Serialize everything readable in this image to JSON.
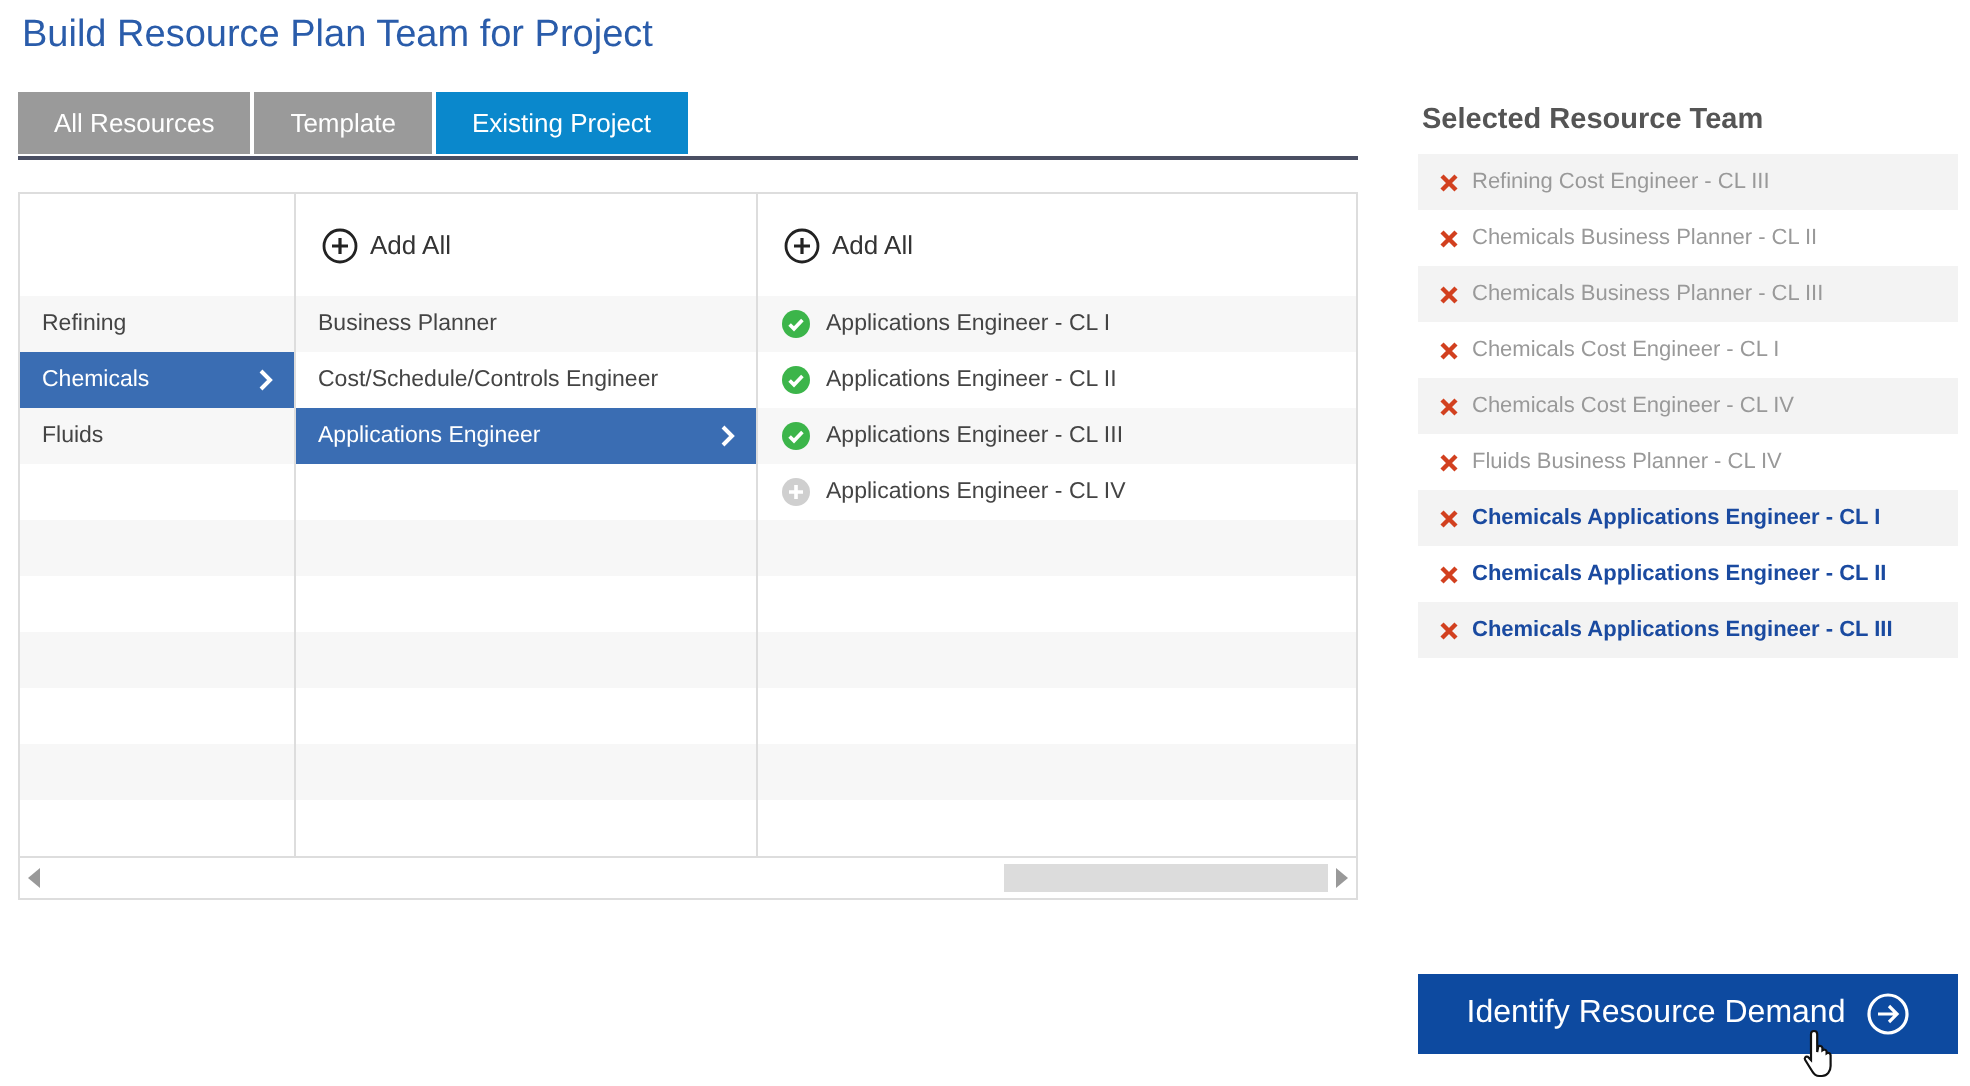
{
  "title": "Build Resource Plan Team for Project",
  "tabs": [
    {
      "label": "All Resources",
      "selected": false
    },
    {
      "label": "Template",
      "selected": false
    },
    {
      "label": "Existing Project",
      "selected": true
    }
  ],
  "browser": {
    "columns": [
      {
        "items": [
          {
            "label": "Refining",
            "selected": false
          },
          {
            "label": "Chemicals",
            "selected": true
          },
          {
            "label": "Fluids",
            "selected": false
          }
        ]
      },
      {
        "add_all": "Add All",
        "items": [
          {
            "label": "Business Planner",
            "selected": false
          },
          {
            "label": "Cost/Schedule/Controls Engineer",
            "selected": false
          },
          {
            "label": "Applications Engineer",
            "selected": true
          }
        ]
      },
      {
        "add_all": "Add All",
        "items": [
          {
            "label": "Applications Engineer - CL I",
            "added": true
          },
          {
            "label": "Applications Engineer - CL II",
            "added": true
          },
          {
            "label": "Applications Engineer - CL III",
            "added": true
          },
          {
            "label": "Applications Engineer - CL IV",
            "added": false
          }
        ]
      }
    ]
  },
  "selected_team": {
    "heading": "Selected Resource Team",
    "items": [
      {
        "label": "Refining Cost Engineer - CL III",
        "new": false
      },
      {
        "label": "Chemicals Business Planner - CL II",
        "new": false
      },
      {
        "label": "Chemicals Business Planner - CL III",
        "new": false
      },
      {
        "label": "Chemicals Cost Engineer - CL I",
        "new": false
      },
      {
        "label": "Chemicals Cost Engineer - CL IV",
        "new": false
      },
      {
        "label": "Fluids Business Planner - CL IV",
        "new": false
      },
      {
        "label": "Chemicals Applications Engineer - CL I",
        "new": true
      },
      {
        "label": "Chemicals Applications Engineer - CL II",
        "new": true
      },
      {
        "label": "Chemicals Applications Engineer - CL III",
        "new": true
      }
    ]
  },
  "action_button": "Identify Resource Demand"
}
